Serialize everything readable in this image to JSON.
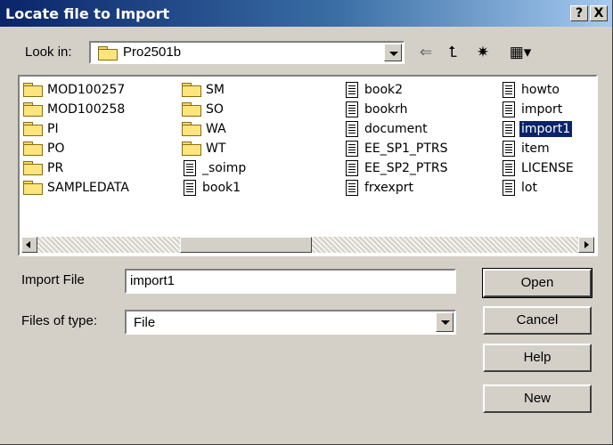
{
  "window": {
    "title": "Locate file to Import",
    "help_btn": "?",
    "close_btn": "X"
  },
  "lookin": {
    "label": "Look in:",
    "value": "Pro2501b"
  },
  "toolbar": {
    "back_glyph": "⇐",
    "up_glyph": "⮤",
    "newfolder_glyph": "✷",
    "view_glyph": "▦▾"
  },
  "files": [
    {
      "name": "MOD100257",
      "kind": "folder"
    },
    {
      "name": "MOD100258",
      "kind": "folder"
    },
    {
      "name": "PI",
      "kind": "folder"
    },
    {
      "name": "PO",
      "kind": "folder"
    },
    {
      "name": "PR",
      "kind": "folder"
    },
    {
      "name": "SAMPLEDATA",
      "kind": "folder"
    },
    {
      "name": "SM",
      "kind": "folder"
    },
    {
      "name": "SO",
      "kind": "folder"
    },
    {
      "name": "WA",
      "kind": "folder"
    },
    {
      "name": "WT",
      "kind": "folder"
    },
    {
      "name": "_soimp",
      "kind": "file"
    },
    {
      "name": "book1",
      "kind": "file"
    },
    {
      "name": "book2",
      "kind": "file"
    },
    {
      "name": "bookrh",
      "kind": "file"
    },
    {
      "name": "document",
      "kind": "file"
    },
    {
      "name": "EE_SP1_PTRS",
      "kind": "file"
    },
    {
      "name": "EE_SP2_PTRS",
      "kind": "file"
    },
    {
      "name": "frxexprt",
      "kind": "file"
    },
    {
      "name": "howto",
      "kind": "file"
    },
    {
      "name": "import",
      "kind": "file"
    },
    {
      "name": "import1",
      "kind": "file",
      "selected": true
    },
    {
      "name": "item",
      "kind": "file"
    },
    {
      "name": "LICENSE",
      "kind": "file"
    },
    {
      "name": "lot",
      "kind": "file"
    }
  ],
  "import_file": {
    "label": "Import File",
    "value": "import1"
  },
  "files_of_type": {
    "label": "Files of type:",
    "value": "File"
  },
  "buttons": {
    "open": "Open",
    "cancel": "Cancel",
    "help": "Help",
    "new": "New"
  }
}
